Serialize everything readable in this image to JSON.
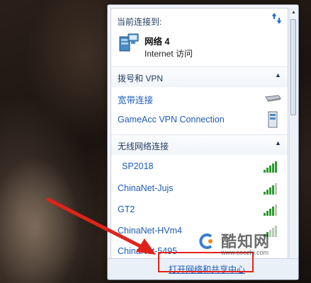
{
  "header": {
    "title": "当前连接到:",
    "network_name": "网络  4",
    "network_status": "Internet 访问"
  },
  "sections": {
    "dialup": {
      "title": "拨号和 VPN",
      "items": [
        "宽带连接",
        "GameAcc VPN Connection"
      ]
    },
    "wireless": {
      "title": "无线网络连接",
      "items": [
        "SP2018",
        "ChinaNet-Jujs",
        "GT2",
        "ChinaNet-HVm4",
        "ChinaNet-5495"
      ]
    }
  },
  "footer": {
    "link": "打开网络和共享中心"
  },
  "watermark": {
    "brand": "酷知网",
    "url": "www.coozhi.com"
  },
  "colors": {
    "link": "#1d5bb5",
    "highlight": "#e0231a",
    "signal": "#2e9a2e"
  }
}
